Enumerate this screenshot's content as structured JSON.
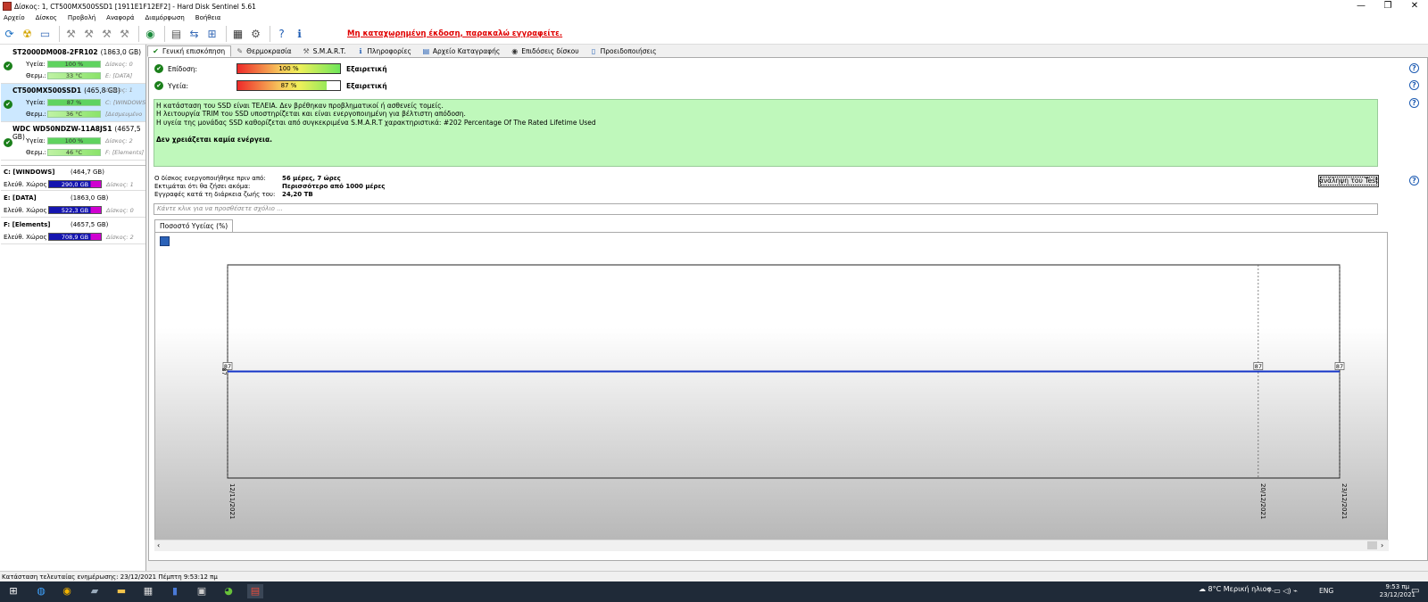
{
  "window": {
    "title": "Δίσκος: 1, CT500MX500SSD1 [1911E1F12EF2]  -  Hard Disk Sentinel 5.61",
    "minimize": "—",
    "maximize": "❐",
    "close": "✕"
  },
  "menu": [
    "Αρχείο",
    "Δίσκος",
    "Προβολή",
    "Αναφορά",
    "Διαμόρφωση",
    "Βοήθεια"
  ],
  "nag_link": "Μη καταχωρημένη έκδοση, παρακαλώ εγγραφείτε.",
  "disks": [
    {
      "name": "ST2000DM008-2FR102",
      "size": "(1863,0 GB)",
      "health_label": "Υγεία:",
      "health": "100 %",
      "health_pct": 100,
      "meta1": "Δίσκος: 0",
      "temp_label": "Θερμ.:",
      "temp": "33 °C",
      "meta2": "E: [DATA]",
      "selected": false
    },
    {
      "name": "CT500MX500SSD1",
      "size": "(465,8 GB)",
      "health_label": "Υγεία:",
      "health": "87 %",
      "health_pct": 87,
      "meta1": "C: [WINDOWS",
      "temp_label": "Θερμ.:",
      "temp": "36 °C",
      "meta2": "[Δεσμευμένο",
      "selected": true,
      "header_meta": "Δίσκος: 1"
    },
    {
      "name": "WDC WD50NDZW-11A8JS1",
      "size": "(4657,5 GB)",
      "health_label": "Υγεία:",
      "health": "100 %",
      "health_pct": 100,
      "meta1": "Δίσκος: 2",
      "temp_label": "Θερμ.:",
      "temp": "46 °C",
      "meta2": "F: [Elements]",
      "selected": false
    }
  ],
  "volumes": [
    {
      "name": "C: [WINDOWS]",
      "size": "(464,7 GB)",
      "free_label": "Ελεύθ. Χώρος",
      "free": "290,0 GB",
      "disk": "Δίσκος: 1"
    },
    {
      "name": "E: [DATA]",
      "size": "(1863,0 GB)",
      "free_label": "Ελεύθ. Χώρος",
      "free": "522,3 GB",
      "disk": "Δίσκος: 0"
    },
    {
      "name": "F: [Elements]",
      "size": "(4657,5 GB)",
      "free_label": "Ελεύθ. Χώρος",
      "free": "708,9 GB",
      "disk": "Δίσκος: 2"
    }
  ],
  "tabs": [
    "Γενική επισκόπηση",
    "Θερμοκρασία",
    "S.M.A.R.T.",
    "Πληροφορίες",
    "Αρχείο Καταγραφής",
    "Επιδόσεις δίσκου",
    "Προειδοποιήσεις"
  ],
  "performance": {
    "label": "Επίδοση:",
    "value": "100 %",
    "pct": 100,
    "rating": "Εξαιρετική"
  },
  "health": {
    "label": "Υγεία:",
    "value": "87 %",
    "pct": 87,
    "rating": "Εξαιρετική"
  },
  "status_text": {
    "line1": "Η κατάσταση του SSD είναι ΤΕΛΕΙΑ. Δεν βρέθηκαν προβληματικοί ή ασθενείς τομείς.",
    "line2": "Η λειτουργία TRIM του SSD υποστηρίζεται και είναι ενεργοποιημένη για βέλτιστη απόδοση.",
    "line3": "Η υγεία  της μονάδας SSD καθορίζεται από συγκεκριμένα S.M.A.R.T χαρακτηριστικά: #202 Percentage Of The Rated Lifetime Used",
    "action": "Δεν χρειάζεται καμία ενέργεια."
  },
  "stats": [
    {
      "label": "Ο δίσκος ενεργοποιήθηκε πριν από:",
      "value": "56 μέρες, 7 ώρες"
    },
    {
      "label": "Εκτιμάται ότι θα ζήσει ακόμα:",
      "value": "Περισσότερο από 1000 μέρες"
    },
    {
      "label": "Εγγραφές κατά τη διάρκεια ζωής του:",
      "value": "24,20 TB"
    }
  ],
  "repeat_button": "Επανάληψη του Test",
  "note_placeholder": "Κάντε κλικ για να προσθέσετε σχόλιο ...",
  "chart_tab": "Ποσοστό Υγείας (%)",
  "chart_data": {
    "type": "line",
    "x": [
      "12/11/2021",
      "20/12/2021",
      "23/12/2021"
    ],
    "series": [
      {
        "values": [
          87,
          87,
          87
        ]
      }
    ],
    "ytick": "87",
    "ylim": [
      0,
      174
    ],
    "line_color": "#1535c8",
    "grid": true
  },
  "statusbar": "Κατάσταση τελευταίας ενημέρωσης: 23/12/2021 Πέμπτη 9:53:12 πμ",
  "taskbar": {
    "weather": "8°C  Μερική ηλιοφ.",
    "lang": "ENG",
    "time": "9:53 πμ",
    "date": "23/12/2021"
  }
}
